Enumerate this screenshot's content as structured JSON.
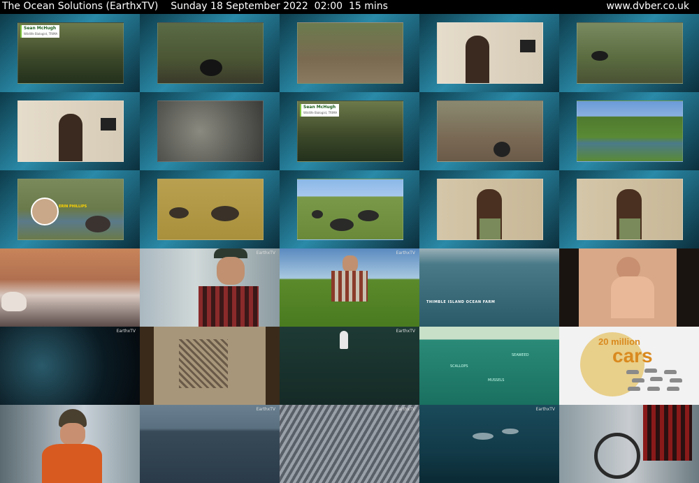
{
  "header": {
    "title": "The Ocean Solutions (EarthxTV)",
    "date": "Sunday 18 September 2022",
    "time": "02:00",
    "duration": "15 mins",
    "site": "www.dvber.co.uk"
  },
  "overlays": {
    "name1": "Sean McHugh",
    "name1_role": "Wildlife Biologist, TRIMA",
    "name2": "Sean McHugh",
    "name2_role": "Wildlife Biologist, TRIMA",
    "presenter": "ERIN PHILLIPS",
    "farm": "THIMBLE ISLAND OCEAN FARM",
    "scallops": "SCALLOPS",
    "mussels": "MUSSELS",
    "seaweed": "SEAWEED",
    "cars_count": "20 million",
    "cars_word": "cars",
    "channel_bug": "EarthxTV"
  },
  "colors": {
    "background": "#000000",
    "header_text": "#ffffff",
    "cars_text": "#d98a1f"
  }
}
